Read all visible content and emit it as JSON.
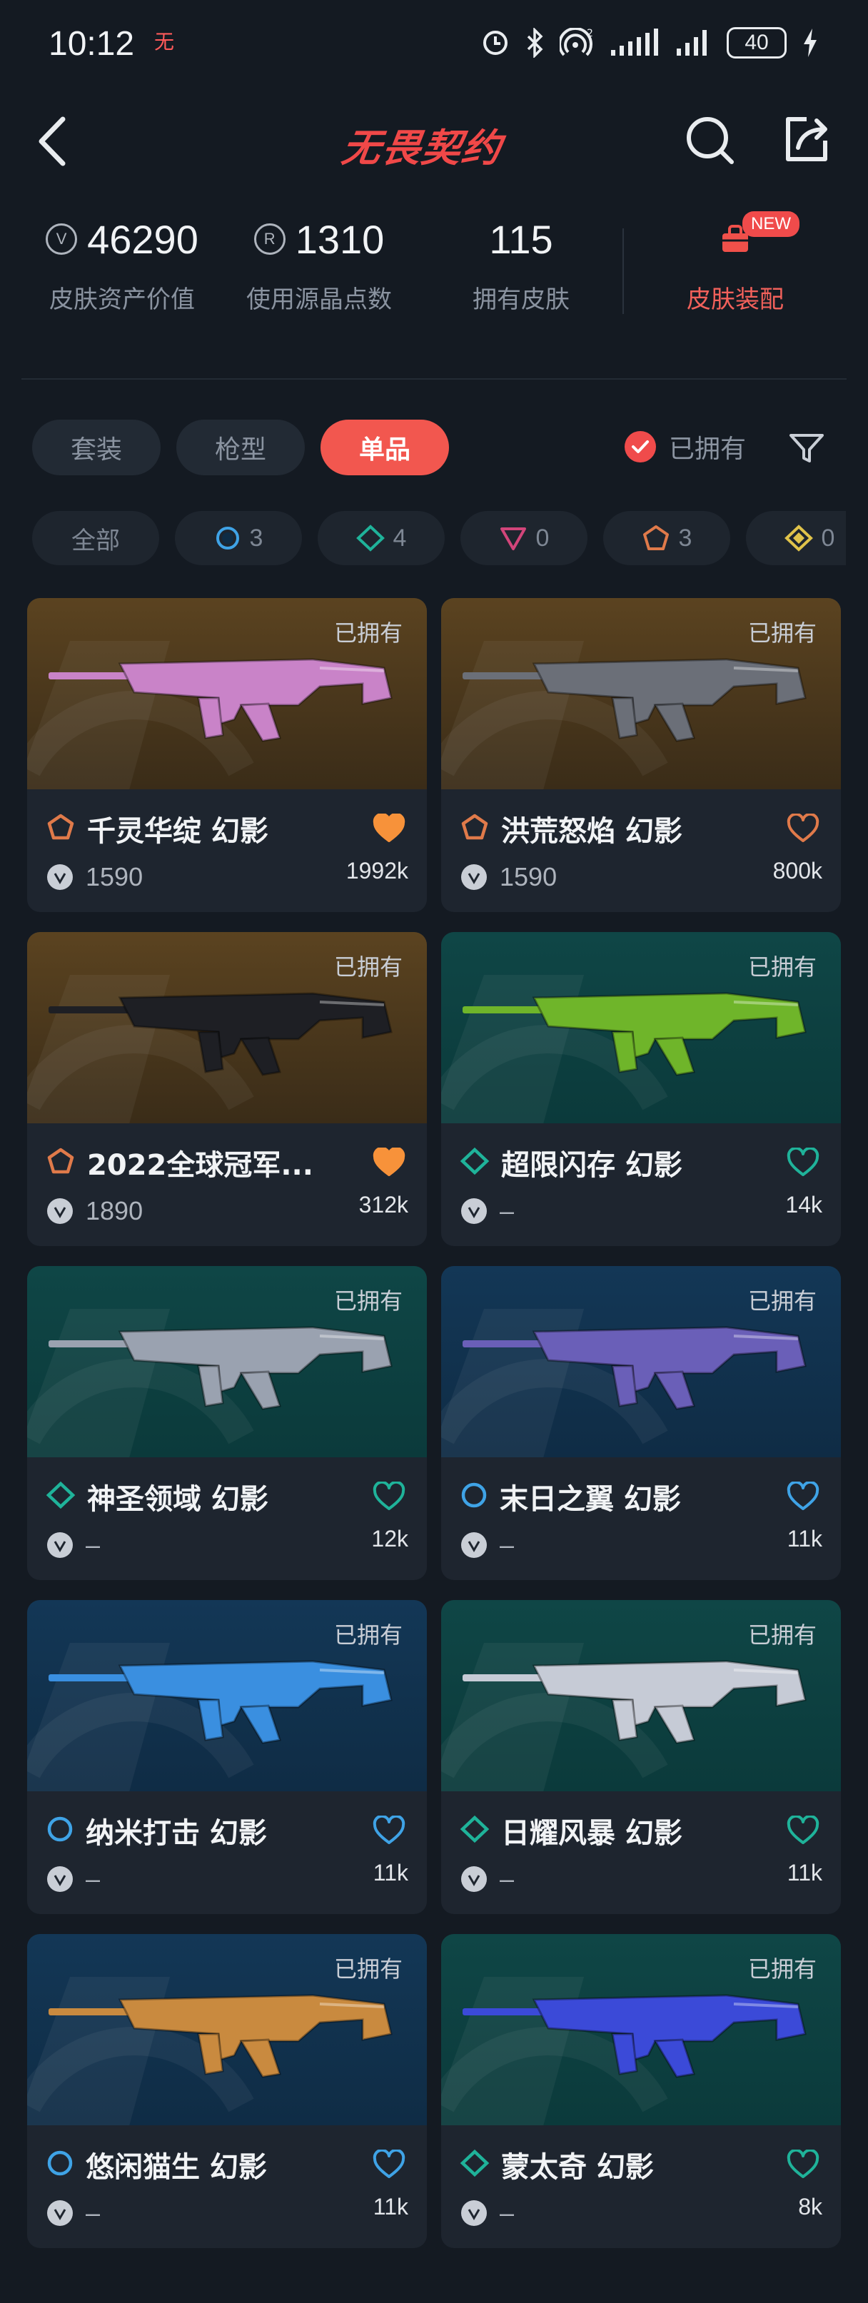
{
  "status": {
    "time": "10:12",
    "battery": "40",
    "network": "2"
  },
  "header": {
    "logo": "无畏契约"
  },
  "stats": [
    {
      "value": "46290",
      "label": "皮肤资产价值",
      "icon": "vp-icon"
    },
    {
      "value": "1310",
      "label": "使用源晶点数",
      "icon": "radianite-icon"
    },
    {
      "value": "115",
      "label": "拥有皮肤",
      "icon": ""
    }
  ],
  "outfit": {
    "label": "皮肤装配",
    "badge": "NEW"
  },
  "tabs": [
    {
      "label": "套装",
      "active": false
    },
    {
      "label": "枪型",
      "active": false
    },
    {
      "label": "单品",
      "active": true
    }
  ],
  "owned_filter": {
    "label": "已拥有",
    "checked": true
  },
  "tiers": [
    {
      "label": "全部",
      "count": ""
    },
    {
      "tier": "select",
      "count": "3",
      "color": "#3fa3e6"
    },
    {
      "tier": "deluxe",
      "count": "4",
      "color": "#1fb39a"
    },
    {
      "tier": "exclusive",
      "count": "0",
      "color": "#d2457a"
    },
    {
      "tier": "premium",
      "count": "3",
      "color": "#e07a4a"
    },
    {
      "tier": "ultra",
      "count": "0",
      "color": "#e0c34a"
    }
  ],
  "skins": [
    {
      "name": "千灵华绽 幻影",
      "price": "1590",
      "likes": "1992k",
      "owned": "已拥有",
      "tier": "premium",
      "liked": true,
      "bg": "gold",
      "gun": "#c983c8"
    },
    {
      "name": "洪荒怒焰 幻影",
      "price": "1590",
      "likes": "800k",
      "owned": "已拥有",
      "tier": "premium",
      "liked": false,
      "bg": "gold",
      "gun": "#6b6f78"
    },
    {
      "name": "2022全球冠军...",
      "price": "1890",
      "likes": "312k",
      "owned": "已拥有",
      "tier": "premium",
      "liked": true,
      "bg": "gold",
      "gun": "#1e1f24"
    },
    {
      "name": "超限闪存 幻影",
      "price": "–",
      "likes": "14k",
      "owned": "已拥有",
      "tier": "deluxe",
      "liked": false,
      "bg": "teal",
      "gun": "#6fb52a"
    },
    {
      "name": "神圣领域 幻影",
      "price": "–",
      "likes": "12k",
      "owned": "已拥有",
      "tier": "deluxe",
      "liked": false,
      "bg": "teal",
      "gun": "#9aa2b0"
    },
    {
      "name": "末日之翼 幻影",
      "price": "–",
      "likes": "11k",
      "owned": "已拥有",
      "tier": "select",
      "liked": false,
      "bg": "blue",
      "gun": "#6a5fb8"
    },
    {
      "name": "纳米打击 幻影",
      "price": "–",
      "likes": "11k",
      "owned": "已拥有",
      "tier": "select",
      "liked": false,
      "bg": "blue",
      "gun": "#3a8fe0"
    },
    {
      "name": "日耀风暴 幻影",
      "price": "–",
      "likes": "11k",
      "owned": "已拥有",
      "tier": "deluxe",
      "liked": false,
      "bg": "teal",
      "gun": "#c6cbd6"
    },
    {
      "name": "悠闲猫生 幻影",
      "price": "–",
      "likes": "11k",
      "owned": "已拥有",
      "tier": "select",
      "liked": false,
      "bg": "blue",
      "gun": "#c98a3f"
    },
    {
      "name": "蒙太奇 幻影",
      "price": "–",
      "likes": "8k",
      "owned": "已拥有",
      "tier": "deluxe",
      "liked": false,
      "bg": "teal",
      "gun": "#3b4ad8"
    }
  ]
}
